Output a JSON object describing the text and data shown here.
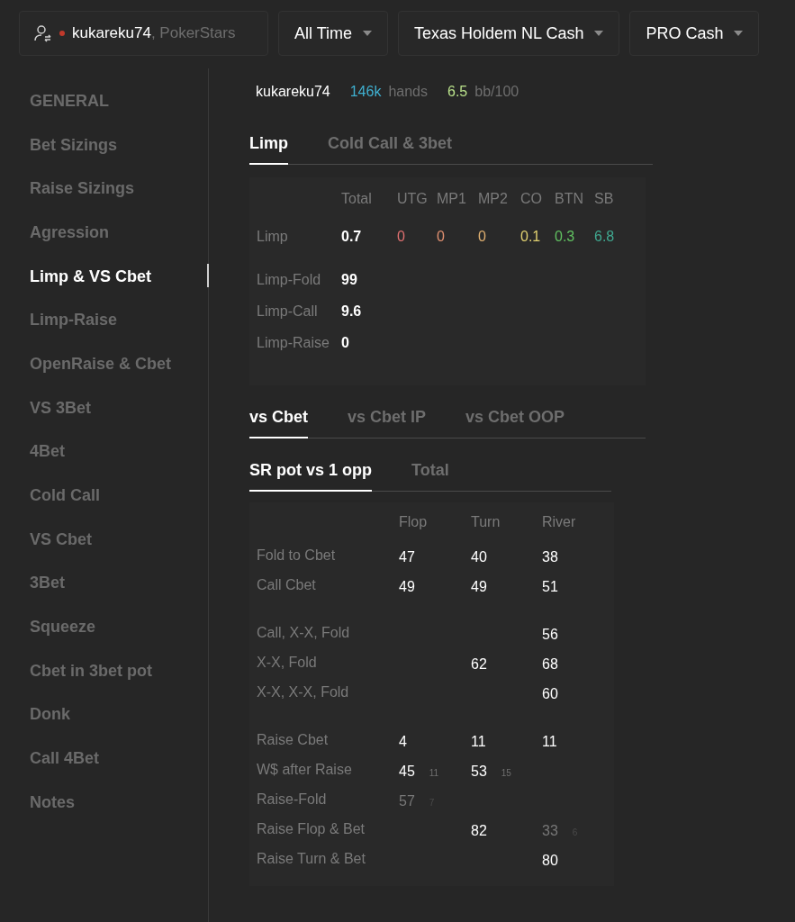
{
  "player_selector": {
    "name": "kukareku74",
    "site": ", PokerStars"
  },
  "filters": [
    {
      "label": "All Time"
    },
    {
      "label": "Texas Holdem NL Cash"
    },
    {
      "label": "PRO Cash"
    }
  ],
  "sidebar": {
    "items": [
      {
        "label": "GENERAL",
        "selected": false
      },
      {
        "label": "Bet Sizings",
        "selected": false
      },
      {
        "label": "Raise Sizings",
        "selected": false
      },
      {
        "label": "Agression",
        "selected": false
      },
      {
        "label": "Limp & VS Cbet",
        "selected": true
      },
      {
        "label": "Limp-Raise",
        "selected": false
      },
      {
        "label": "OpenRaise & Cbet",
        "selected": false
      },
      {
        "label": "VS 3Bet",
        "selected": false
      },
      {
        "label": "4Bet",
        "selected": false
      },
      {
        "label": "Cold Call",
        "selected": false
      },
      {
        "label": "VS Cbet",
        "selected": false
      },
      {
        "label": "3Bet",
        "selected": false
      },
      {
        "label": "Squeeze",
        "selected": false
      },
      {
        "label": "Cbet in 3bet pot",
        "selected": false
      },
      {
        "label": "Donk",
        "selected": false
      },
      {
        "label": "Call 4Bet",
        "selected": false
      },
      {
        "label": "Notes",
        "selected": false
      }
    ]
  },
  "summary": {
    "player": "kukareku74",
    "hands": "146k",
    "hands_label": "hands",
    "winrate": "6.5",
    "winrate_label": "bb/100"
  },
  "limp_tabs": [
    {
      "label": "Limp",
      "selected": true
    },
    {
      "label": "Cold Call & 3bet",
      "selected": false
    }
  ],
  "limp_table": {
    "columns": [
      "Total",
      "UTG",
      "MP1",
      "MP2",
      "CO",
      "BTN",
      "SB"
    ],
    "rows": [
      {
        "label": "Limp",
        "total": "0.7",
        "positions": [
          {
            "value": "0",
            "color": "#e07070"
          },
          {
            "value": "0",
            "color": "#e09070"
          },
          {
            "value": "0",
            "color": "#e0b070"
          },
          {
            "value": "0.1",
            "color": "#e0d070"
          },
          {
            "value": "0.3",
            "color": "#60c060"
          },
          {
            "value": "6.8",
            "color": "#40a890"
          }
        ]
      },
      {
        "label": "Limp-Fold",
        "total": "99"
      },
      {
        "label": "Limp-Call",
        "total": "9.6"
      },
      {
        "label": "Limp-Raise",
        "total": "0"
      }
    ]
  },
  "cbet_tabs": [
    {
      "label": "vs Cbet",
      "selected": true
    },
    {
      "label": "vs Cbet IP",
      "selected": false
    },
    {
      "label": "vs Cbet OOP",
      "selected": false
    }
  ],
  "pot_tabs": [
    {
      "label": "SR pot vs 1 opp",
      "selected": true
    },
    {
      "label": "Total",
      "selected": false
    }
  ],
  "cbet_table": {
    "columns": [
      "Flop",
      "Turn",
      "River"
    ],
    "groups": [
      {
        "rows": [
          {
            "label": "Fold to Cbet",
            "cells": [
              {
                "value": "47",
                "dim": false
              },
              {
                "value": "40",
                "dim": false
              },
              {
                "value": "38",
                "dim": false
              }
            ]
          },
          {
            "label": "Call Cbet",
            "cells": [
              {
                "value": "49",
                "dim": false
              },
              {
                "value": "49",
                "dim": false
              },
              {
                "value": "51",
                "dim": false
              }
            ]
          }
        ]
      },
      {
        "rows": [
          {
            "label": "Call, X-X, Fold",
            "cells": [
              {},
              {},
              {
                "value": "56",
                "dim": false
              }
            ]
          },
          {
            "label": "X-X, Fold",
            "cells": [
              {},
              {
                "value": "62",
                "dim": false
              },
              {
                "value": "68",
                "dim": false
              }
            ]
          },
          {
            "label": "X-X, X-X, Fold",
            "cells": [
              {},
              {},
              {
                "value": "60",
                "dim": false
              }
            ]
          }
        ]
      },
      {
        "rows": [
          {
            "label": "Raise Cbet",
            "cells": [
              {
                "value": "4",
                "dim": false
              },
              {
                "value": "11",
                "dim": false
              },
              {
                "value": "11",
                "dim": false
              }
            ]
          },
          {
            "label": "W$ after Raise",
            "cells": [
              {
                "value": "45",
                "sample": "11",
                "dim": false
              },
              {
                "value": "53",
                "sample": "15",
                "dim": false
              },
              {}
            ]
          },
          {
            "label": "Raise-Fold",
            "cells": [
              {
                "value": "57",
                "sample": "7",
                "dim": true
              },
              {},
              {}
            ]
          },
          {
            "label": "Raise Flop & Bet",
            "cells": [
              {},
              {
                "value": "82",
                "dim": false
              },
              {
                "value": "33",
                "sample": "6",
                "dim": true
              }
            ]
          },
          {
            "label": "Raise Turn & Bet",
            "cells": [
              {},
              {},
              {
                "value": "80",
                "dim": false
              }
            ]
          }
        ]
      }
    ]
  }
}
